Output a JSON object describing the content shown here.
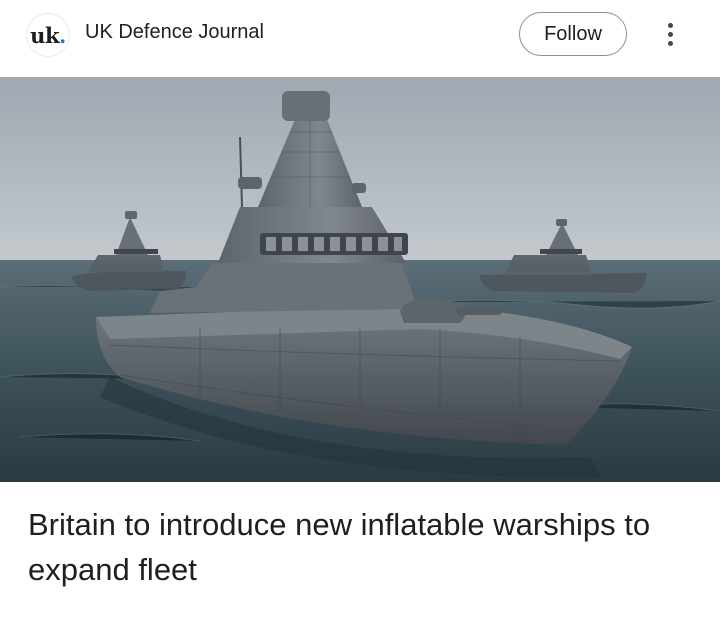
{
  "header": {
    "logo_text": "uk",
    "logo_dot": ".",
    "publisher_name": "UK Defence Journal",
    "follow_label": "Follow"
  },
  "hero": {
    "icon": "inflatable-warships-image"
  },
  "article": {
    "headline": "Britain to introduce new inflatable warships to expand fleet"
  },
  "colors": {
    "sky": "#aab3bb",
    "sea": "#3f5460",
    "hull": "#5a6168",
    "accent": "#1a73e8"
  }
}
